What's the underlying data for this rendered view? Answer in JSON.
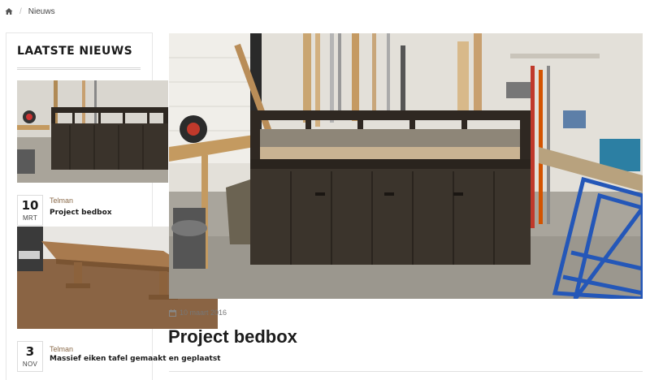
{
  "breadcrumb": {
    "home_icon": "home-icon",
    "separator": "/",
    "current": "Nieuws"
  },
  "sidebar": {
    "title": "LAATSTE NIEUWS",
    "items": [
      {
        "day": "10",
        "month": "MRT",
        "author": "Telman",
        "title": "Project bedbox",
        "thumb": "bedbox-workshop-photo"
      },
      {
        "day": "3",
        "month": "NOV",
        "author": "Telman",
        "title": "Massief eiken tafel gemaakt en geplaatst",
        "thumb": "oak-table-photo"
      }
    ]
  },
  "post": {
    "image": "bedbox-workshop-photo",
    "date_icon": "calendar-icon",
    "date": "10 maart 2016",
    "title": "Project bedbox"
  },
  "colors": {
    "accent": "#8a6a4a",
    "text": "#1c1c1c",
    "border": "#e0e0e0"
  }
}
